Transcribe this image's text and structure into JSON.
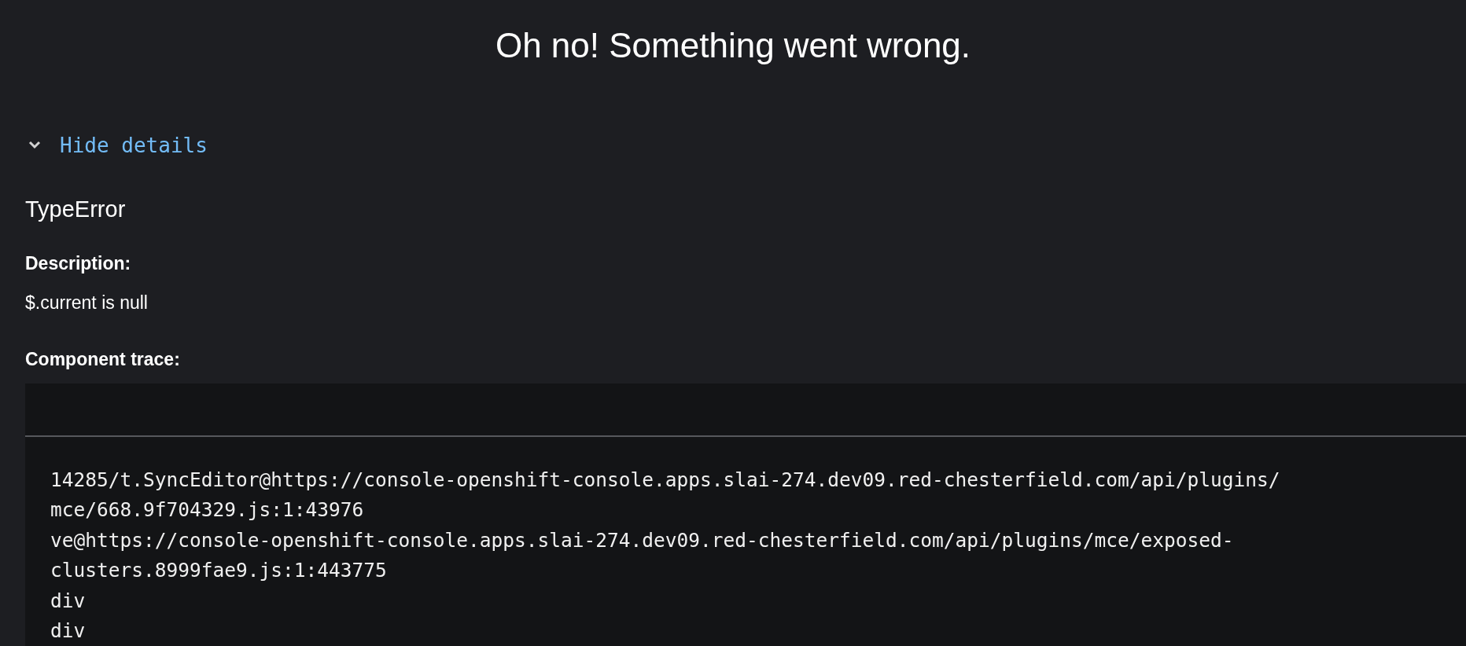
{
  "title": "Oh no! Something went wrong.",
  "details_toggle": {
    "label": "Hide details",
    "expanded": true
  },
  "error_name": "TypeError",
  "description": {
    "label": "Description:",
    "text": "$.current is null"
  },
  "component_trace": {
    "label": "Component trace:",
    "lines": [
      "14285/t.SyncEditor@https://console-openshift-console.apps.slai-274.dev09.red-chesterfield.com/api/plugins/",
      "mce/668.9f704329.js:1:43976",
      "ve@https://console-openshift-console.apps.slai-274.dev09.red-chesterfield.com/api/plugins/mce/exposed-",
      "clusters.8999fae9.js:1:443775",
      "div",
      "div"
    ]
  }
}
